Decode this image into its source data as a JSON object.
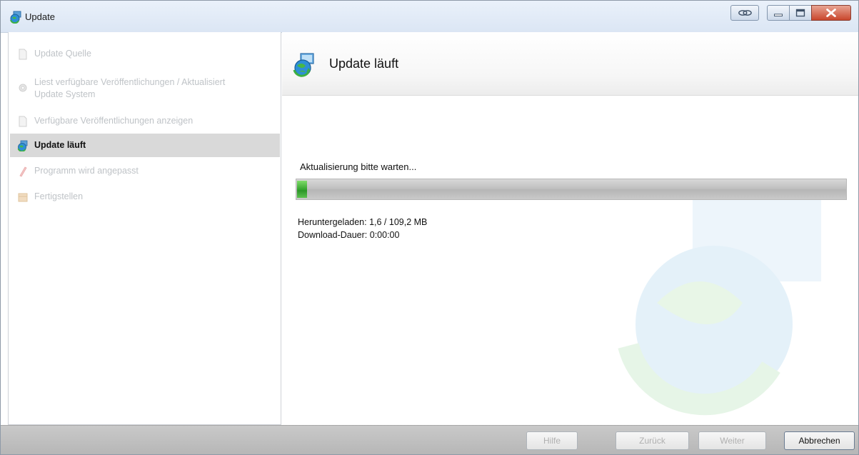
{
  "window": {
    "title": "Update"
  },
  "sidebar": {
    "steps": [
      {
        "label": "Update Quelle",
        "icon": "document-icon",
        "state": "disabled"
      },
      {
        "label": "Liest verfügbare Veröffentlichungen / Aktualisiert Update System",
        "icon": "gear-icon",
        "state": "disabled"
      },
      {
        "label": "Verfügbare Veröffentlichungen anzeigen",
        "icon": "document-icon",
        "state": "disabled"
      },
      {
        "label": "Update läuft",
        "icon": "globe-update-icon",
        "state": "active"
      },
      {
        "label": "Programm wird angepasst",
        "icon": "pencil-icon",
        "state": "disabled"
      },
      {
        "label": "Fertigstellen",
        "icon": "box-icon",
        "state": "disabled"
      }
    ]
  },
  "header": {
    "title": "Update läuft"
  },
  "main": {
    "status": "Aktualisierung bitte warten...",
    "progress": 0.015,
    "downloaded": "Heruntergeladen: 1,6 / 109,2 MB",
    "duration": "Download-Dauer: 0:00:00"
  },
  "footer": {
    "help": "Hilfe",
    "back": "Zurück",
    "next": "Weiter",
    "cancel": "Abbrechen"
  },
  "colors": {
    "progress_fill": "#2fa02a",
    "active_step_bg": "#d9d9d9",
    "close_button": "#c9462c"
  }
}
